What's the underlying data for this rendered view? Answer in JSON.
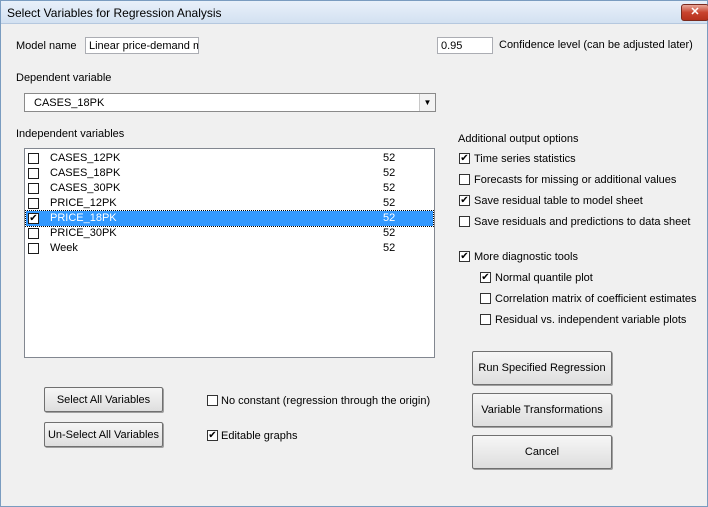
{
  "window": {
    "title": "Select Variables for Regression Analysis",
    "close_label": "✕"
  },
  "model": {
    "label": "Model name",
    "value": "Linear price-demand mode"
  },
  "confidence": {
    "value": "0.95",
    "label": "Confidence level (can be adjusted later)"
  },
  "dependent": {
    "label": "Dependent variable",
    "selected": "CASES_18PK"
  },
  "independent": {
    "label": "Independent variables",
    "rows": [
      {
        "name": "CASES_12PK",
        "count": "52",
        "checked": false,
        "selected": false
      },
      {
        "name": "CASES_18PK",
        "count": "52",
        "checked": false,
        "selected": false
      },
      {
        "name": "CASES_30PK",
        "count": "52",
        "checked": false,
        "selected": false
      },
      {
        "name": "PRICE_12PK",
        "count": "52",
        "checked": false,
        "selected": false
      },
      {
        "name": "PRICE_18PK",
        "count": "52",
        "checked": true,
        "selected": true
      },
      {
        "name": "PRICE_30PK",
        "count": "52",
        "checked": false,
        "selected": false
      },
      {
        "name": "Week",
        "count": "52",
        "checked": false,
        "selected": false
      }
    ]
  },
  "options": {
    "heading": "Additional output options",
    "time_series": {
      "label": "Time series statistics",
      "checked": true
    },
    "forecasts": {
      "label": "Forecasts for missing or additional values",
      "checked": false
    },
    "save_residual_table": {
      "label": "Save residual table to model sheet",
      "checked": true
    },
    "save_residuals_data": {
      "label": "Save residuals and predictions to data sheet",
      "checked": false
    },
    "more_diagnostics": {
      "label": "More diagnostic tools",
      "checked": true
    },
    "normal_quantile": {
      "label": "Normal quantile plot",
      "checked": true
    },
    "correlation_matrix": {
      "label": "Correlation matrix of coefficient estimates",
      "checked": false
    },
    "residual_vs_independent": {
      "label": "Residual vs. independent variable plots",
      "checked": false
    }
  },
  "no_constant": {
    "label": "No constant (regression through the origin)",
    "checked": false
  },
  "editable_graphs": {
    "label": "Editable graphs",
    "checked": true
  },
  "buttons": {
    "select_all": "Select All Variables",
    "unselect_all": "Un-Select All Variables",
    "run": "Run Specified Regression",
    "transformations": "Variable Transformations",
    "cancel": "Cancel"
  },
  "icons": {
    "check": "✔",
    "dropdown": "▼"
  }
}
